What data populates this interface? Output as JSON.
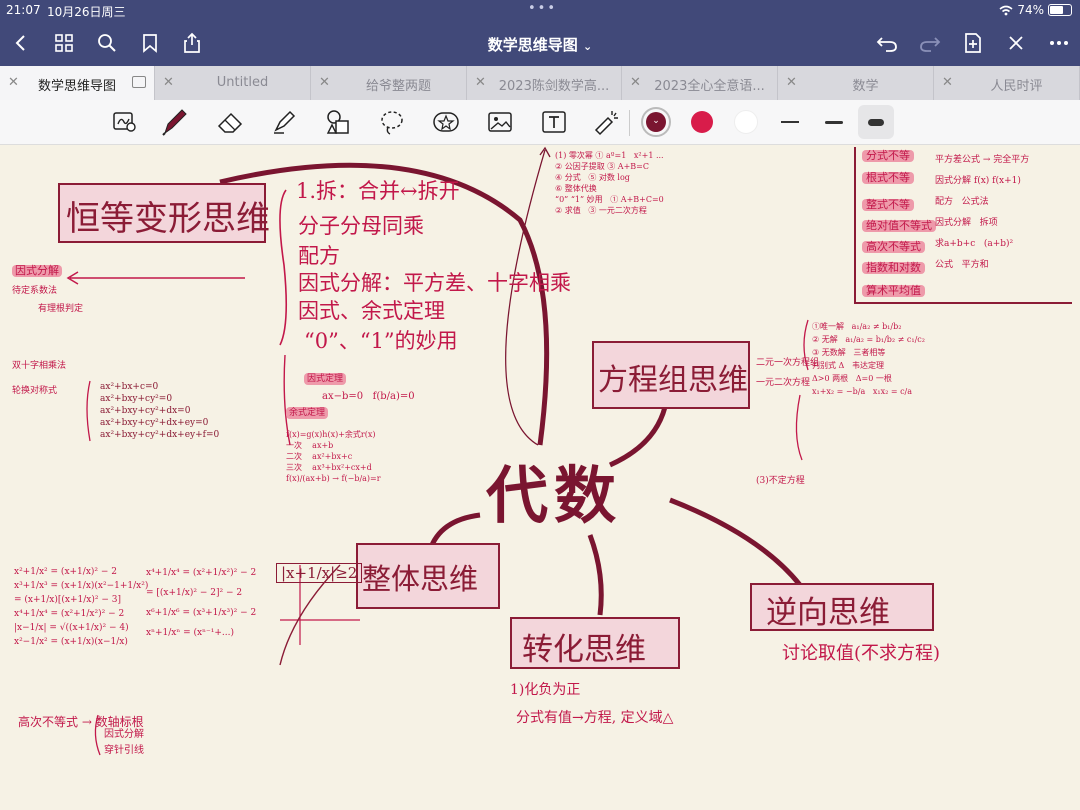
{
  "status": {
    "time": "21:07",
    "date": "10月26日周三",
    "battery": "74%",
    "battery_level": 0.74
  },
  "nav": {
    "title": "数学思维导图"
  },
  "tabs": [
    {
      "label": "数学思维导图",
      "active": true
    },
    {
      "label": "Untitled"
    },
    {
      "label": "给爷整两题"
    },
    {
      "label": "2023陈剑数学高..."
    },
    {
      "label": "2023全心全意语..."
    },
    {
      "label": "数学"
    },
    {
      "label": "人民时评"
    }
  ],
  "colors": {
    "ink_dark": "#8b1c36",
    "ink_red": "#c2184a",
    "box_fill": "#f3d6db",
    "navbar": "#414979",
    "paper": "#f6f2e5"
  },
  "map": {
    "center": "代数",
    "branches": {
      "identity": "恒等变形思维",
      "equation": "方程组思维",
      "whole": "整体思维",
      "transform": "转化思维",
      "reverse": "逆向思维"
    },
    "identity_notes": [
      "1.拆：合并↔拆开",
      "分子分母同乘",
      "配方",
      "因式分解：平方差、十字相乘",
      "因式、余式定理",
      "“0”、“1”的妙用"
    ],
    "reverse_note": "讨论取值(不求方程)",
    "transform_notes": [
      "1)化负为正",
      "分式有值→方程, 定义域△"
    ],
    "left_top": [
      "因式分解",
      "待定系数法",
      "有理根判定",
      "双十字相乘法",
      "轮换对称式"
    ],
    "bottom_left_notes": [
      "高次不等式 → 数轴标根",
      "因式分解",
      "穿针引线"
    ],
    "whole_formula": "|x+1/x|≥2",
    "right_panel": [
      "分式不等",
      "根式不等",
      "整式不等",
      "绝对值不等式",
      "高次不等式",
      "指数和对数",
      "算术平均值"
    ],
    "middle_notes": [
      "因式定理",
      "余式定理"
    ],
    "equation_notes": [
      "二元一次方程组",
      "一元二次方程",
      "(3)不定方程"
    ]
  }
}
